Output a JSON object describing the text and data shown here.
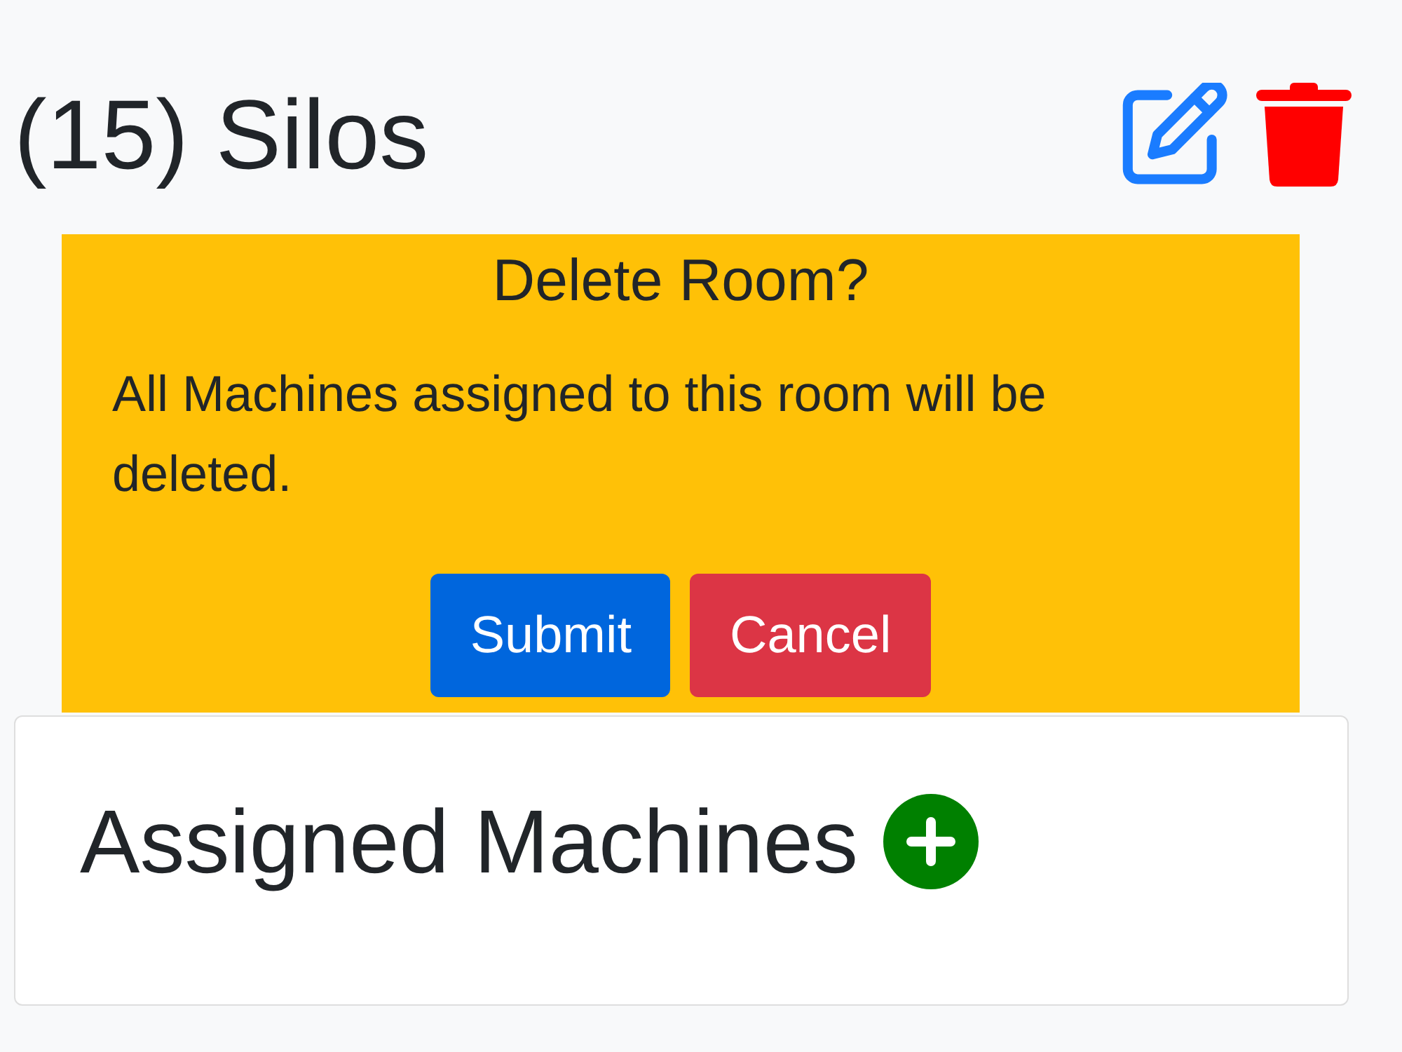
{
  "header": {
    "title": "(15) Silos"
  },
  "confirm_dialog": {
    "title": "Delete Room?",
    "message": "All Machines assigned to this room will be deleted.",
    "buttons": [
      {
        "label": "Submit",
        "kind": "primary"
      },
      {
        "label": "Cancel",
        "kind": "danger"
      }
    ]
  },
  "card": {
    "title": "Assigned Machines"
  }
}
